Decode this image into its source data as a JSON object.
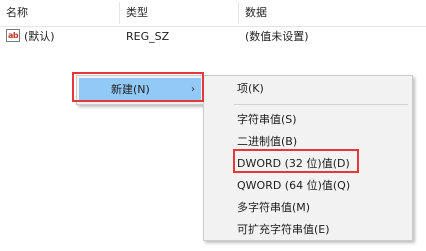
{
  "columns": {
    "name": "名称",
    "type": "类型",
    "data": "数据"
  },
  "row": {
    "icon": "ab",
    "name": "(默认)",
    "type": "REG_SZ",
    "data": "(数值未设置)"
  },
  "context_menu": {
    "new_label": "新建(N)",
    "arrow": "›"
  },
  "submenu": {
    "items": [
      "项(K)",
      "字符串值(S)",
      "二进制值(B)",
      "DWORD (32 位)值(D)",
      "QWORD (64 位)值(Q)",
      "多字符串值(M)",
      "可扩充字符串值(E)"
    ]
  },
  "colors": {
    "highlight": "#91c9f7",
    "annotation_box": "#e5383b"
  }
}
